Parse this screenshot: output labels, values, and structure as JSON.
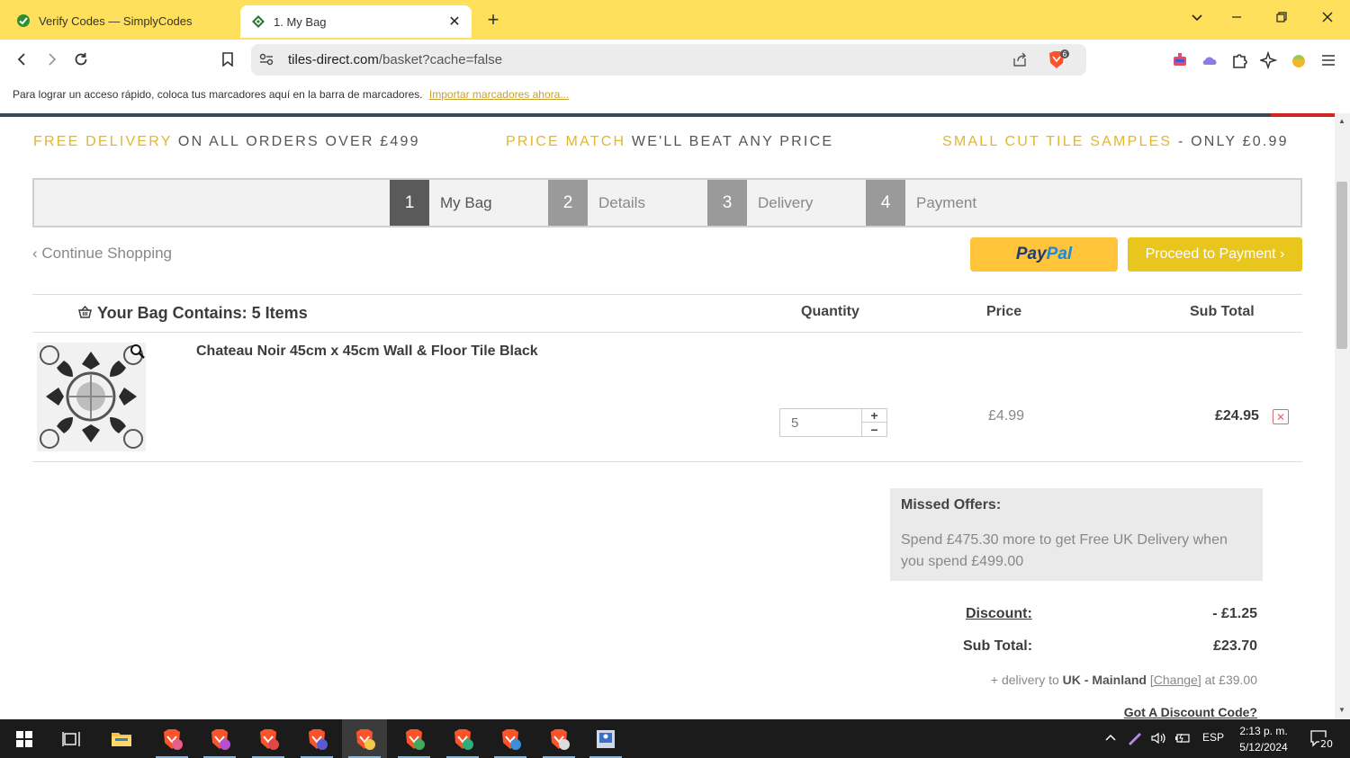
{
  "browser": {
    "tabs": [
      {
        "title": "Verify Codes — SimplyCodes",
        "active": false
      },
      {
        "title": "1. My Bag",
        "active": true
      }
    ],
    "url_host": "tiles-direct.com",
    "url_path": "/basket?cache=false",
    "brave_badge": "6",
    "bookmarks_text": "Para lograr un acceso rápido, coloca tus marcadores aquí en la barra de marcadores.",
    "bookmarks_link": "Importar marcadores ahora..."
  },
  "promo": [
    {
      "highlight": "FREE DELIVERY",
      "rest": " ON ALL ORDERS OVER £499"
    },
    {
      "highlight": "PRICE MATCH",
      "rest": " WE'LL BEAT ANY PRICE"
    },
    {
      "highlight": "SMALL CUT TILE SAMPLES",
      "rest": " - ONLY £0.99"
    }
  ],
  "steps": [
    {
      "num": "1",
      "label": "My Bag"
    },
    {
      "num": "2",
      "label": "Details"
    },
    {
      "num": "3",
      "label": "Delivery"
    },
    {
      "num": "4",
      "label": "Payment"
    }
  ],
  "actions": {
    "continue": "‹ Continue Shopping",
    "paypal_pay": "Pay",
    "paypal_pal": "Pal",
    "proceed": "Proceed to Payment ›"
  },
  "bag": {
    "title": "Your Bag Contains: 5 Items",
    "col_quantity": "Quantity",
    "col_price": "Price",
    "col_subtotal": "Sub Total",
    "items": [
      {
        "name": "Chateau Noir 45cm x 45cm Wall & Floor Tile Black",
        "quantity": "5",
        "price": "£4.99",
        "subtotal": "£24.95"
      }
    ]
  },
  "missed": {
    "title": "Missed Offers:",
    "body": "Spend £475.30 more to get Free UK Delivery when you spend £499.00"
  },
  "totals": {
    "discount_label": "Discount:",
    "discount_value": "- £1.25",
    "subtotal_label": "Sub Total:",
    "subtotal_value": "£23.70",
    "delivery_prefix": "+ delivery to",
    "delivery_region": "UK - Mainland",
    "delivery_change": "[Change]",
    "delivery_suffix": "at £39.00",
    "discount_code_link": "Got A Discount Code?"
  },
  "taskbar": {
    "lang": "ESP",
    "time": "2:13 p. m.",
    "date": "5/12/2024",
    "notifications": "20"
  },
  "colors": {
    "tabstrip": "#ffe05c",
    "accent_gold": "#e1b72d",
    "paypal_yellow": "#ffc439",
    "proceed_yellow": "#e8c61e"
  }
}
